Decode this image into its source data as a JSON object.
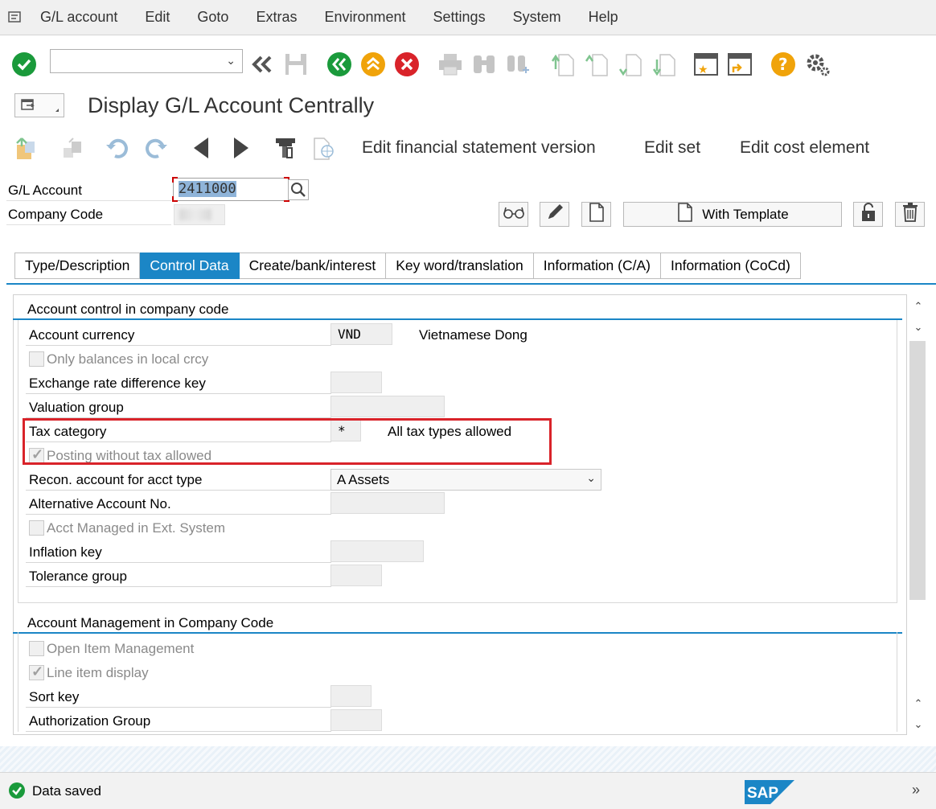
{
  "menu": {
    "items": [
      "G/L account",
      "Edit",
      "Goto",
      "Extras",
      "Environment",
      "Settings",
      "System",
      "Help"
    ]
  },
  "toolbar": {
    "command_field_value": "",
    "icons": [
      "enter-icon",
      "back-icon",
      "save-icon",
      "back-green-icon",
      "exit-icon",
      "cancel-icon",
      "print-icon",
      "find-icon",
      "find-next-icon",
      "first-page-icon",
      "previous-page-icon",
      "next-page-icon",
      "last-page-icon",
      "create-session-icon",
      "shortcut-icon",
      "help-icon",
      "settings-icon"
    ]
  },
  "title": {
    "text": "Display G/L Account Centrally"
  },
  "app_toolbar": {
    "edit_fs_version": "Edit financial statement version",
    "edit_set": "Edit set",
    "edit_cost_element": "Edit cost element"
  },
  "header": {
    "gl_account_label": "G/L Account",
    "gl_account_value": "2411000",
    "company_code_label": "Company Code",
    "with_template_label": "With Template"
  },
  "tabs": [
    {
      "label": "Type/Description",
      "active": false
    },
    {
      "label": "Control Data",
      "active": true
    },
    {
      "label": "Create/bank/interest",
      "active": false
    },
    {
      "label": "Key word/translation",
      "active": false
    },
    {
      "label": "Information (C/A)",
      "active": false
    },
    {
      "label": "Information (CoCd)",
      "active": false
    }
  ],
  "account_control": {
    "title": "Account control in company code",
    "account_currency_label": "Account currency",
    "account_currency_value": "VND",
    "account_currency_text": "Vietnamese Dong",
    "only_balances_label": "Only balances in local crcy",
    "only_balances_checked": false,
    "exchange_rate_label": "Exchange rate difference key",
    "valuation_group_label": "Valuation group",
    "tax_category_label": "Tax category",
    "tax_category_value": "*",
    "tax_category_text": "All tax types allowed",
    "posting_without_tax_label": "Posting without tax allowed",
    "posting_without_tax_checked": true,
    "recon_account_label": "Recon. account for acct type",
    "recon_account_value": "A Assets",
    "alt_account_label": "Alternative Account No.",
    "acct_managed_label": "Acct Managed in Ext. System",
    "acct_managed_checked": false,
    "inflation_key_label": "Inflation key",
    "tolerance_group_label": "Tolerance group"
  },
  "account_management": {
    "title": "Account Management in Company Code",
    "open_item_label": "Open Item Management",
    "open_item_checked": false,
    "line_item_label": "Line item display",
    "line_item_checked": true,
    "sort_key_label": "Sort key",
    "authorization_group_label": "Authorization Group"
  },
  "status": {
    "message": "Data saved",
    "logo": "SAP"
  },
  "colors": {
    "accent": "#1b86c6",
    "highlight_border": "#d9232a",
    "success_green": "#1a9a3b",
    "help_orange": "#f0a30a"
  }
}
